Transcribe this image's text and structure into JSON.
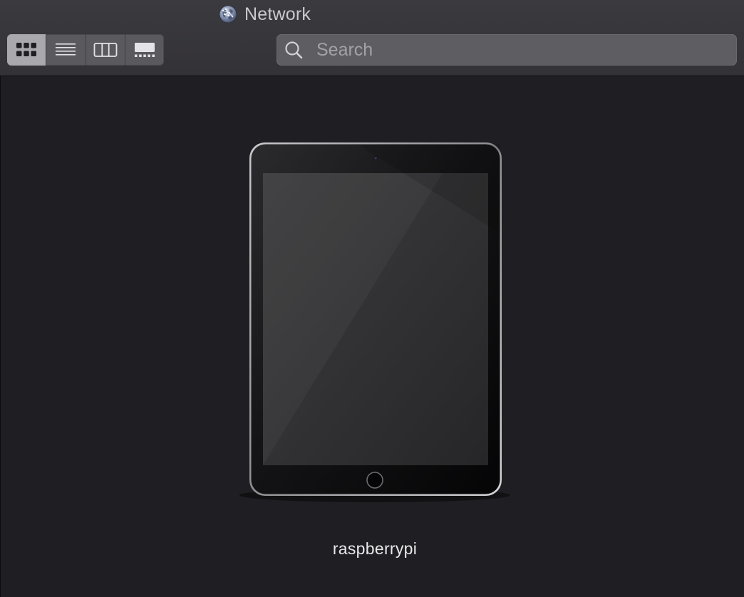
{
  "window": {
    "title": "Network",
    "title_icon": "globe-network-icon"
  },
  "toolbar": {
    "view_modes": [
      {
        "name": "icon-view",
        "icon": "grid-icon",
        "active": true
      },
      {
        "name": "list-view",
        "icon": "list-icon",
        "active": false
      },
      {
        "name": "column-view",
        "icon": "columns-icon",
        "active": false
      },
      {
        "name": "gallery-view",
        "icon": "gallery-icon",
        "active": false
      }
    ],
    "search": {
      "placeholder": "Search",
      "value": ""
    }
  },
  "content": {
    "items": [
      {
        "label": "raspberrypi",
        "icon": "ipad-device-icon"
      }
    ]
  },
  "colors": {
    "titlebar": "#38373b",
    "content_bg": "#1f1e22",
    "active_segment": "#a9a8ad",
    "text": "#e8e8ea"
  }
}
